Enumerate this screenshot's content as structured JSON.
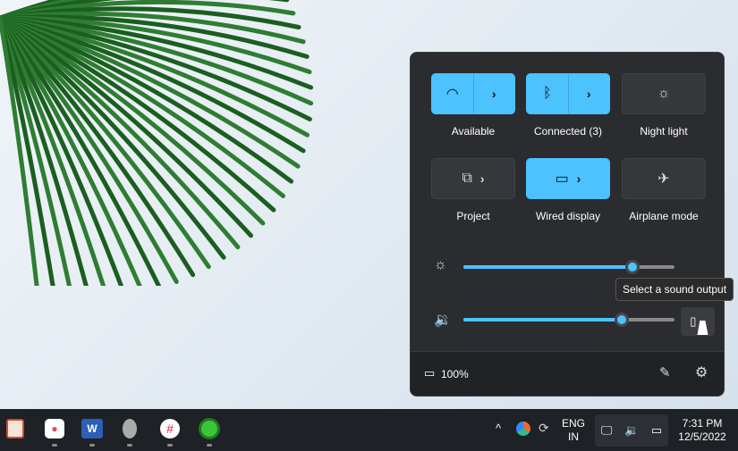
{
  "quick_settings": {
    "tiles": [
      {
        "label": "Available",
        "icon": "wifi-icon",
        "active": true
      },
      {
        "label": "Connected (3)",
        "icon": "bluetooth-icon",
        "active": true
      },
      {
        "label": "Night light",
        "icon": "night-light-icon",
        "active": false
      },
      {
        "label": "Project",
        "icon": "project-icon",
        "active": false
      },
      {
        "label": "Wired display",
        "icon": "cast-icon",
        "active": true
      },
      {
        "label": "Airplane mode",
        "icon": "airplane-icon",
        "active": false
      }
    ],
    "brightness_percent": 80,
    "volume_percent": 75,
    "tooltip": "Select a sound output",
    "battery": "100%",
    "accent": "#4cc2ff"
  },
  "taskbar": {
    "apps": [
      "snipping-tool",
      "asana",
      "word",
      "app-grey",
      "slack",
      "green-app"
    ],
    "language": {
      "line1": "ENG",
      "line2": "IN"
    },
    "time": "7:31 PM",
    "date": "12/5/2022"
  }
}
